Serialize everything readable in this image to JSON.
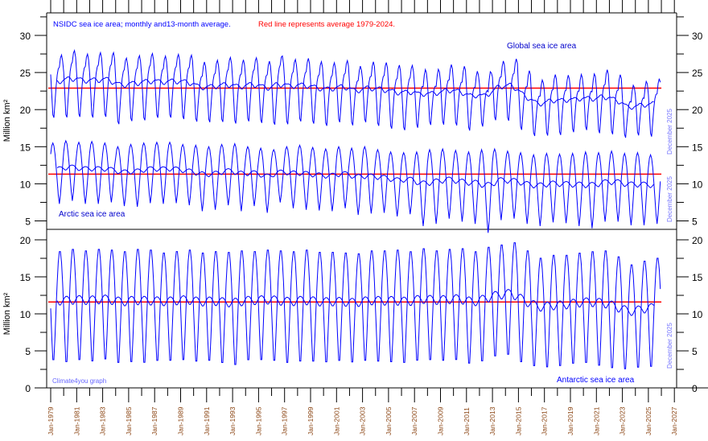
{
  "chart_data": [
    {
      "type": "line",
      "panel": "top",
      "title": "NSIDC sea ice area; monthly and13-month average.",
      "title_note": "Red line represents average 1979-2024.",
      "ylabel": "Million km²",
      "ylim": [
        3,
        33
      ],
      "yticks": [
        5,
        10,
        15,
        20,
        25,
        30
      ],
      "xlim": [
        "1978-09",
        "2026-04"
      ],
      "series_labels": {
        "global": "Global sea ice area",
        "arctic": "Arctic sea ice area"
      },
      "end_label": "December 2025",
      "reference_lines": {
        "global": 22.9,
        "arctic": 11.3
      },
      "series_color": "#0000ff",
      "reference_color": "#ff0000"
    },
    {
      "type": "line",
      "panel": "bottom",
      "ylabel": "Million km²",
      "ylim": [
        0,
        20
      ],
      "yticks": [
        0,
        5,
        10,
        15,
        20
      ],
      "series_labels": {
        "antarctic": "Antarctic sea ice area"
      },
      "end_label": "December 2025",
      "reference_lines": {
        "antarctic": 11.6
      },
      "credit": "Climate4you graph"
    }
  ],
  "series": {
    "years": [
      1979,
      1980,
      1981,
      1982,
      1983,
      1984,
      1985,
      1986,
      1987,
      1988,
      1989,
      1990,
      1991,
      1992,
      1993,
      1994,
      1995,
      1996,
      1997,
      1998,
      1999,
      2000,
      2001,
      2002,
      2003,
      2004,
      2005,
      2006,
      2007,
      2008,
      2009,
      2010,
      2011,
      2012,
      2013,
      2014,
      2015,
      2016,
      2017,
      2018,
      2019,
      2020,
      2021,
      2022,
      2023,
      2024,
      2025
    ],
    "arctic_annual_max": [
      15.5,
      15.8,
      15.6,
      15.7,
      15.5,
      15.0,
      15.3,
      15.5,
      15.6,
      15.6,
      15.3,
      15.2,
      15.0,
      15.3,
      15.4,
      15.0,
      14.8,
      14.6,
      15.0,
      15.2,
      14.9,
      14.7,
      15.0,
      14.8,
      15.0,
      14.6,
      14.3,
      14.2,
      14.3,
      14.6,
      14.7,
      14.5,
      14.3,
      14.6,
      14.7,
      14.4,
      14.2,
      13.9,
      14.1,
      14.0,
      14.1,
      14.3,
      14.2,
      14.4,
      14.1,
      14.2,
      13.9
    ],
    "arctic_annual_min": [
      7.3,
      7.7,
      7.3,
      7.3,
      7.5,
      7.0,
      6.9,
      7.4,
      7.3,
      7.4,
      7.1,
      6.3,
      6.5,
      7.1,
      6.3,
      7.0,
      6.1,
      7.5,
      6.7,
      6.5,
      6.4,
      6.3,
      6.7,
      5.8,
      6.0,
      6.1,
      5.6,
      5.9,
      4.3,
      4.6,
      5.3,
      4.9,
      4.6,
      3.4,
      5.1,
      5.3,
      4.6,
      4.3,
      4.8,
      4.7,
      4.3,
      4.0,
      4.9,
      4.9,
      4.4,
      4.4,
      4.6
    ],
    "antarctic_annual_max": [
      18.6,
      18.9,
      18.7,
      18.9,
      18.8,
      18.6,
      18.9,
      18.8,
      18.4,
      18.6,
      18.8,
      18.4,
      18.6,
      18.5,
      18.7,
      18.6,
      18.8,
      18.7,
      18.6,
      18.8,
      18.5,
      18.5,
      18.4,
      18.3,
      18.7,
      18.7,
      18.8,
      18.6,
      19.0,
      18.7,
      18.9,
      19.0,
      18.6,
      19.2,
      19.5,
      19.8,
      18.7,
      17.7,
      18.1,
      18.1,
      18.4,
      18.6,
      18.7,
      17.9,
      16.8,
      17.3,
      17.7
    ],
    "antarctic_annual_min": [
      2.9,
      2.6,
      2.9,
      2.7,
      3.0,
      2.5,
      2.6,
      2.5,
      2.8,
      2.8,
      2.9,
      2.7,
      2.8,
      2.5,
      2.2,
      2.9,
      2.9,
      2.8,
      2.5,
      2.7,
      2.7,
      2.6,
      2.8,
      2.6,
      2.8,
      2.7,
      2.6,
      2.5,
      2.8,
      2.9,
      2.8,
      2.9,
      2.4,
      2.7,
      3.4,
      3.6,
      2.6,
      2.1,
      1.9,
      2.1,
      2.4,
      2.5,
      2.1,
      1.8,
      1.7,
      1.9,
      2.0
    ]
  },
  "x_tick_labels": [
    "Jan-1979",
    "Jan-1981",
    "Jan-1983",
    "Jan-1985",
    "Jan-1987",
    "Jan-1989",
    "Jan-1991",
    "Jan-1993",
    "Jan-1995",
    "Jan-1997",
    "Jan-1999",
    "Jan-2001",
    "Jan-2003",
    "Jan-2005",
    "Jan-2007",
    "Jan-2009",
    "Jan-2011",
    "Jan-2013",
    "Jan-2015",
    "Jan-2017",
    "Jan-2019",
    "Jan-2021",
    "Jan-2023",
    "Jan-2025",
    "Jan-2027"
  ]
}
